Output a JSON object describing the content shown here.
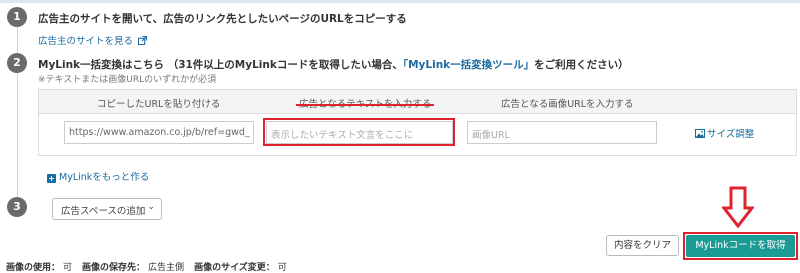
{
  "steps": [
    {
      "number": "1",
      "title": "広告主のサイトを開いて、広告のリンク先としたいページのURLをコピーする",
      "link": "広告主のサイトを見る",
      "link_icon": "external-link-icon"
    },
    {
      "number": "2",
      "title_prefix": "MyLink一括変換はこちら （31件以上のMyLinkコードを取得したい場合、",
      "title_link": "「MyLink一括変換ツール」",
      "title_suffix": "をご利用ください）",
      "note": "※テキストまたは画像URLのいずれかが必須"
    },
    {
      "number": "3"
    }
  ],
  "table": {
    "headers": [
      "コピーしたURLを貼り付ける",
      "広告となるテキストを入力する",
      "広告となる画像URLを入力する"
    ],
    "url_value": "https://www.amazon.co.jp/b/ref=gwd_",
    "text_placeholder": "表示したいテキスト文言をここに",
    "image_placeholder": "画像URL",
    "size_adjust_label": "サイズ調整",
    "size_adjust_icon": "image-icon"
  },
  "more_link": "MyLinkをもっと作る",
  "more_icon": "plus-square-icon",
  "ad_space_select": "広告スペースの追加",
  "buttons": {
    "clear": "内容をクリア",
    "get": "MyLinkコードを取得"
  },
  "footer": {
    "use_label": "画像の使用：",
    "use_value": "可",
    "save_label": "画像の保存先：",
    "save_value": "広告主側",
    "resize_label": "画像のサイズ変更：",
    "resize_value": "可"
  },
  "colors": {
    "accent": "#1a6ba0",
    "primary_button": "#1a9c95",
    "highlight": "#e0222f"
  }
}
